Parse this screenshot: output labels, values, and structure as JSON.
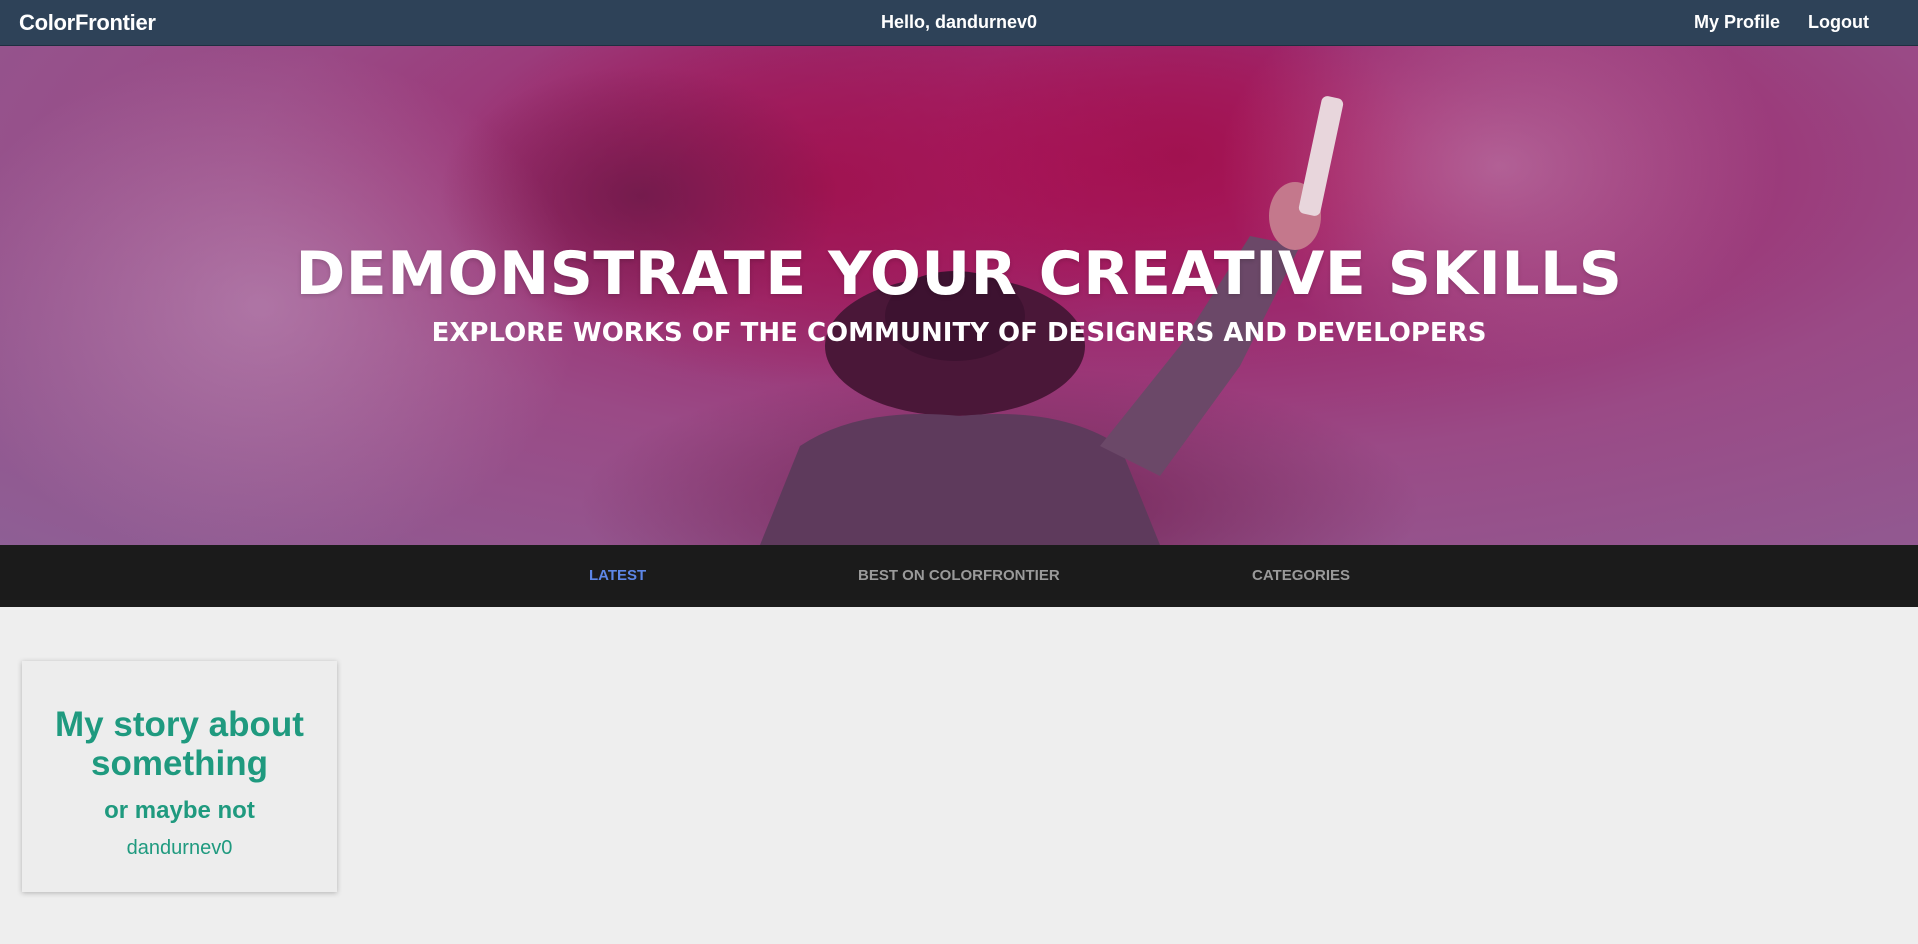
{
  "header": {
    "brand": "ColorFrontier",
    "greeting": "Hello, dandurnev0",
    "nav": {
      "profile_label": "My Profile",
      "logout_label": "Logout"
    }
  },
  "hero": {
    "title": "DEMONSTRATE YOUR CREATIVE SKILLS",
    "subtitle": "EXPLORE WORKS OF THE COMMUNITY OF DESIGNERS AND DEVELOPERS"
  },
  "tabs": [
    {
      "label": "LATEST",
      "active": true
    },
    {
      "label": "BEST ON COLORFRONTIER",
      "active": false
    },
    {
      "label": "CATEGORIES",
      "active": false
    }
  ],
  "posts": [
    {
      "title": "My story about something",
      "subtitle": "or maybe not",
      "author": "dandurnev0"
    }
  ],
  "colors": {
    "header_bg": "#2e4258",
    "tabs_bg": "#1b1b1b",
    "active_tab": "#5d86e6",
    "inactive_tab": "#9a9a9a",
    "card_text": "#1f9a7f",
    "page_bg": "#eeeeee"
  }
}
